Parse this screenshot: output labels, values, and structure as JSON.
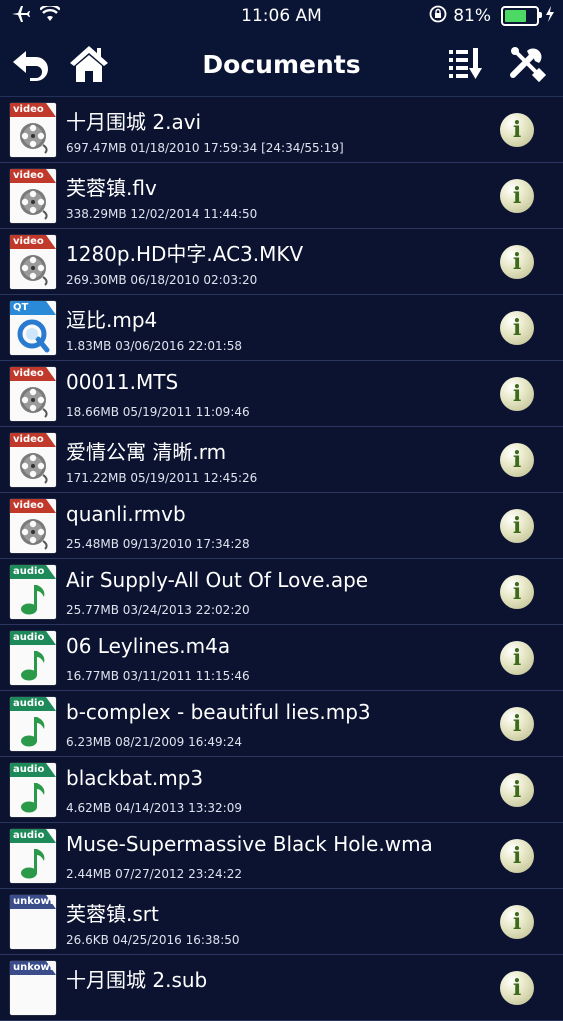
{
  "status": {
    "time": "11:06 AM",
    "battery": "81%",
    "battery_level": 0.81
  },
  "nav": {
    "title": "Documents"
  },
  "colors": {
    "video": "#c0392b",
    "audio": "#1e8a5a",
    "qt": "#2a8ad8",
    "unknown": "#3a4d8a"
  },
  "files": [
    {
      "type": "video",
      "tag": "video",
      "name": "十月围城 2.avi",
      "meta": "697.47MB   01/18/2010 17:59:34  [24:34/55:19]"
    },
    {
      "type": "video",
      "tag": "video",
      "name": "芙蓉镇.flv",
      "meta": "338.29MB   12/02/2014 11:44:50"
    },
    {
      "type": "video",
      "tag": "video",
      "name": "1280p.HD中字.AC3.MKV",
      "meta": "269.30MB   06/18/2010 02:03:20"
    },
    {
      "type": "qt",
      "tag": "QT",
      "name": "逗比.mp4",
      "meta": "1.83MB   03/06/2016 22:01:58"
    },
    {
      "type": "video",
      "tag": "video",
      "name": "00011.MTS",
      "meta": "18.66MB   05/19/2011 11:09:46"
    },
    {
      "type": "video",
      "tag": "video",
      "name": "爱情公寓 清晰.rm",
      "meta": "171.22MB   05/19/2011 12:45:26"
    },
    {
      "type": "video",
      "tag": "video",
      "name": "quanli.rmvb",
      "meta": "25.48MB   09/13/2010 17:34:28"
    },
    {
      "type": "audio",
      "tag": "audio",
      "name": "Air Supply-All Out Of Love.ape",
      "meta": "25.77MB   03/24/2013 22:02:20"
    },
    {
      "type": "audio",
      "tag": "audio",
      "name": "06 Leylines.m4a",
      "meta": "16.77MB   03/11/2011 11:15:46"
    },
    {
      "type": "audio",
      "tag": "audio",
      "name": "b-complex - beautiful lies.mp3",
      "meta": "6.23MB   08/21/2009 16:49:24"
    },
    {
      "type": "audio",
      "tag": "audio",
      "name": "blackbat.mp3",
      "meta": "4.62MB   04/14/2013 13:32:09"
    },
    {
      "type": "audio",
      "tag": "audio",
      "name": "Muse-Supermassive Black Hole.wma",
      "meta": "2.44MB   07/27/2012 23:24:22"
    },
    {
      "type": "unknown",
      "tag": "unkown",
      "name": "芙蓉镇.srt",
      "meta": "26.6KB   04/25/2016 16:38:50"
    },
    {
      "type": "unknown",
      "tag": "unkown",
      "name": "十月围城 2.sub",
      "meta": ""
    }
  ]
}
